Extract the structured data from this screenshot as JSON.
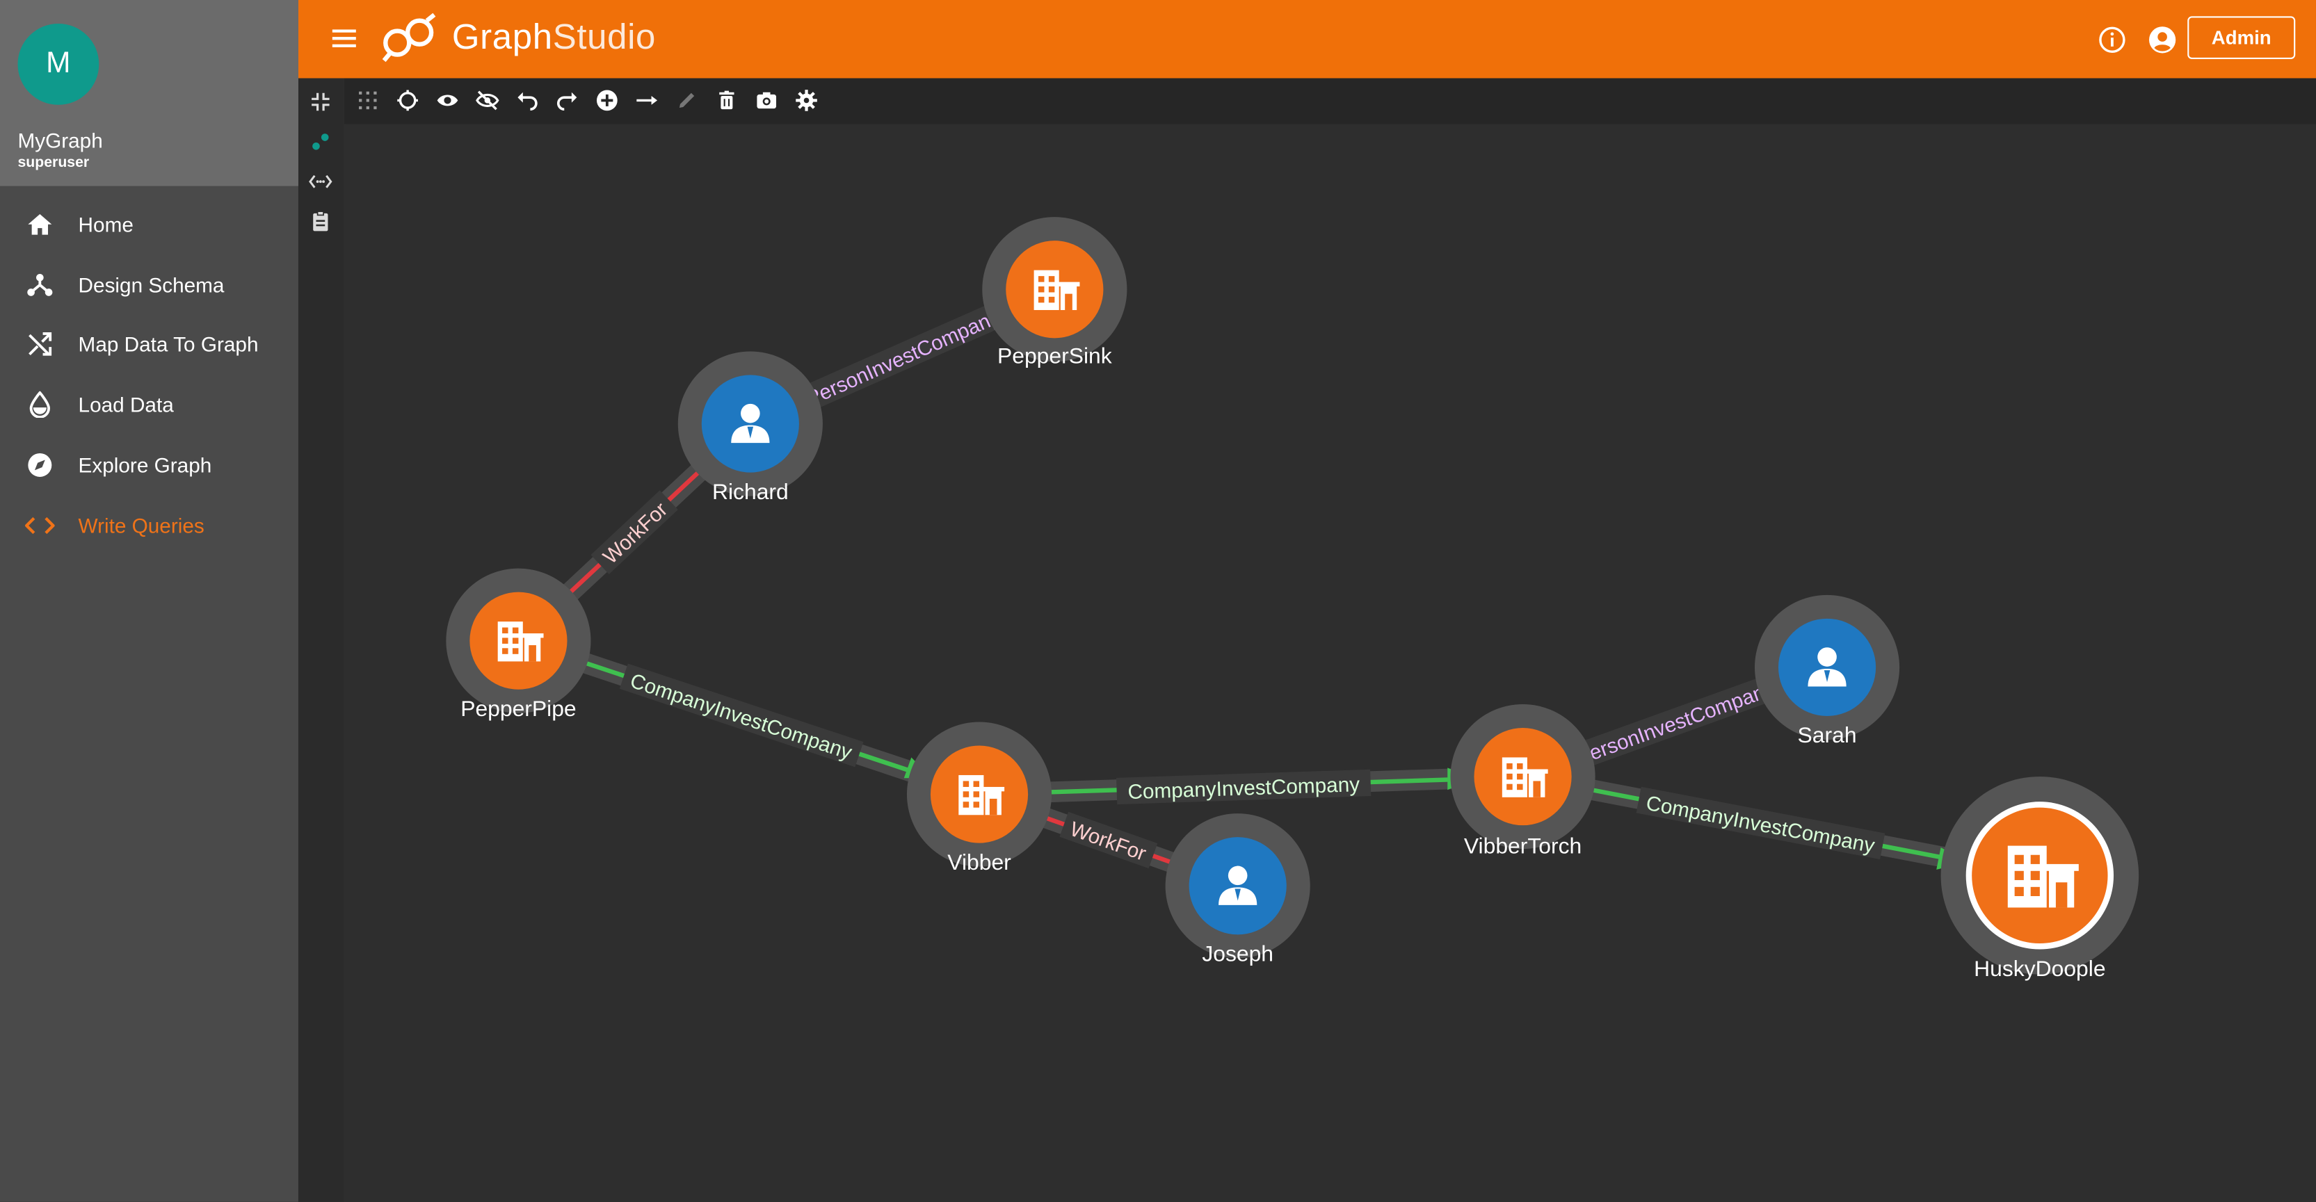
{
  "app": {
    "logo_part1": "Graph",
    "logo_part2": "Studio",
    "brand_color": "#f07009"
  },
  "profile": {
    "avatar_letter": "M",
    "graph_name": "MyGraph",
    "role": "superuser",
    "avatar_color": "#0f9a8c"
  },
  "nav": {
    "items": [
      {
        "label": "Home",
        "icon": "home-icon"
      },
      {
        "label": "Design Schema",
        "icon": "schema-icon"
      },
      {
        "label": "Map Data To Graph",
        "icon": "shuffle-icon"
      },
      {
        "label": "Load Data",
        "icon": "drop-icon"
      },
      {
        "label": "Explore Graph",
        "icon": "compass-icon"
      },
      {
        "label": "Write Queries",
        "icon": "code-icon",
        "active": true
      }
    ]
  },
  "header": {
    "admin_label": "Admin"
  },
  "graph": {
    "vertices": [
      {
        "id": "PepperSink",
        "label": "PepperSink",
        "type": "company"
      },
      {
        "id": "Richard",
        "label": "Richard",
        "type": "person"
      },
      {
        "id": "PepperPipe",
        "label": "PepperPipe",
        "type": "company"
      },
      {
        "id": "Vibber",
        "label": "Vibber",
        "type": "company"
      },
      {
        "id": "Joseph",
        "label": "Joseph",
        "type": "person"
      },
      {
        "id": "VibberTorch",
        "label": "VibberTorch",
        "type": "company"
      },
      {
        "id": "Sarah",
        "label": "Sarah",
        "type": "person"
      },
      {
        "id": "HuskyDoople",
        "label": "HuskyDoople",
        "type": "company",
        "selected": true
      }
    ],
    "edges": [
      {
        "from": "Richard",
        "to": "PepperSink",
        "label": "PersonInvestCompany",
        "color": "#5a5a5a",
        "text_color": "#e6b3ff"
      },
      {
        "from": "PepperPipe",
        "to": "Richard",
        "label": "WorkFor",
        "color": "#e0383e",
        "text_color": "#ffd0d0"
      },
      {
        "from": "PepperPipe",
        "to": "Vibber",
        "label": "CompanyInvestCompany",
        "color": "#3fbf4f",
        "text_color": "#d8ffd8",
        "directed": true
      },
      {
        "from": "Vibber",
        "to": "Joseph",
        "label": "WorkFor",
        "color": "#e0383e",
        "text_color": "#ffd0d0"
      },
      {
        "from": "Vibber",
        "to": "VibberTorch",
        "label": "CompanyInvestCompany",
        "color": "#3fbf4f",
        "text_color": "#d8ffd8",
        "directed": true
      },
      {
        "from": "Sarah",
        "to": "VibberTorch",
        "label": "PersonInvestCompany",
        "color": "#5a5a5a",
        "text_color": "#e6b3ff"
      },
      {
        "from": "VibberTorch",
        "to": "HuskyDoople",
        "label": "CompanyInvestCompany",
        "color": "#3fbf4f",
        "text_color": "#d8ffd8",
        "directed": true
      }
    ],
    "colors": {
      "company": "#f07018",
      "person": "#1f78c1"
    }
  }
}
